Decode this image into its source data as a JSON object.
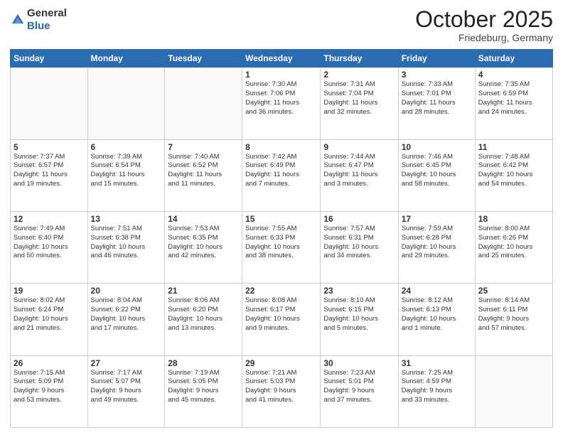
{
  "logo": {
    "general": "General",
    "blue": "Blue"
  },
  "header": {
    "month": "October 2025",
    "location": "Friedeburg, Germany"
  },
  "days": [
    "Sunday",
    "Monday",
    "Tuesday",
    "Wednesday",
    "Thursday",
    "Friday",
    "Saturday"
  ],
  "weeks": [
    [
      {
        "day": "",
        "content": ""
      },
      {
        "day": "",
        "content": ""
      },
      {
        "day": "",
        "content": ""
      },
      {
        "day": "1",
        "content": "Sunrise: 7:30 AM\nSunset: 7:06 PM\nDaylight: 11 hours\nand 36 minutes."
      },
      {
        "day": "2",
        "content": "Sunrise: 7:31 AM\nSunset: 7:04 PM\nDaylight: 11 hours\nand 32 minutes."
      },
      {
        "day": "3",
        "content": "Sunrise: 7:33 AM\nSunset: 7:01 PM\nDaylight: 11 hours\nand 28 minutes."
      },
      {
        "day": "4",
        "content": "Sunrise: 7:35 AM\nSunset: 6:59 PM\nDaylight: 11 hours\nand 24 minutes."
      }
    ],
    [
      {
        "day": "5",
        "content": "Sunrise: 7:37 AM\nSunset: 6:57 PM\nDaylight: 11 hours\nand 19 minutes."
      },
      {
        "day": "6",
        "content": "Sunrise: 7:39 AM\nSunset: 6:54 PM\nDaylight: 11 hours\nand 15 minutes."
      },
      {
        "day": "7",
        "content": "Sunrise: 7:40 AM\nSunset: 6:52 PM\nDaylight: 11 hours\nand 11 minutes."
      },
      {
        "day": "8",
        "content": "Sunrise: 7:42 AM\nSunset: 6:49 PM\nDaylight: 11 hours\nand 7 minutes."
      },
      {
        "day": "9",
        "content": "Sunrise: 7:44 AM\nSunset: 6:47 PM\nDaylight: 11 hours\nand 3 minutes."
      },
      {
        "day": "10",
        "content": "Sunrise: 7:46 AM\nSunset: 6:45 PM\nDaylight: 10 hours\nand 58 minutes."
      },
      {
        "day": "11",
        "content": "Sunrise: 7:48 AM\nSunset: 6:42 PM\nDaylight: 10 hours\nand 54 minutes."
      }
    ],
    [
      {
        "day": "12",
        "content": "Sunrise: 7:49 AM\nSunset: 6:40 PM\nDaylight: 10 hours\nand 50 minutes."
      },
      {
        "day": "13",
        "content": "Sunrise: 7:51 AM\nSunset: 6:38 PM\nDaylight: 10 hours\nand 46 minutes."
      },
      {
        "day": "14",
        "content": "Sunrise: 7:53 AM\nSunset: 6:35 PM\nDaylight: 10 hours\nand 42 minutes."
      },
      {
        "day": "15",
        "content": "Sunrise: 7:55 AM\nSunset: 6:33 PM\nDaylight: 10 hours\nand 38 minutes."
      },
      {
        "day": "16",
        "content": "Sunrise: 7:57 AM\nSunset: 6:31 PM\nDaylight: 10 hours\nand 34 minutes."
      },
      {
        "day": "17",
        "content": "Sunrise: 7:59 AM\nSunset: 6:28 PM\nDaylight: 10 hours\nand 29 minutes."
      },
      {
        "day": "18",
        "content": "Sunrise: 8:00 AM\nSunset: 6:26 PM\nDaylight: 10 hours\nand 25 minutes."
      }
    ],
    [
      {
        "day": "19",
        "content": "Sunrise: 8:02 AM\nSunset: 6:24 PM\nDaylight: 10 hours\nand 21 minutes."
      },
      {
        "day": "20",
        "content": "Sunrise: 8:04 AM\nSunset: 6:22 PM\nDaylight: 10 hours\nand 17 minutes."
      },
      {
        "day": "21",
        "content": "Sunrise: 8:06 AM\nSunset: 6:20 PM\nDaylight: 10 hours\nand 13 minutes."
      },
      {
        "day": "22",
        "content": "Sunrise: 8:08 AM\nSunset: 6:17 PM\nDaylight: 10 hours\nand 9 minutes."
      },
      {
        "day": "23",
        "content": "Sunrise: 8:10 AM\nSunset: 6:15 PM\nDaylight: 10 hours\nand 5 minutes."
      },
      {
        "day": "24",
        "content": "Sunrise: 8:12 AM\nSunset: 6:13 PM\nDaylight: 10 hours\nand 1 minute."
      },
      {
        "day": "25",
        "content": "Sunrise: 8:14 AM\nSunset: 6:11 PM\nDaylight: 9 hours\nand 57 minutes."
      }
    ],
    [
      {
        "day": "26",
        "content": "Sunrise: 7:15 AM\nSunset: 5:09 PM\nDaylight: 9 hours\nand 53 minutes."
      },
      {
        "day": "27",
        "content": "Sunrise: 7:17 AM\nSunset: 5:07 PM\nDaylight: 9 hours\nand 49 minutes."
      },
      {
        "day": "28",
        "content": "Sunrise: 7:19 AM\nSunset: 5:05 PM\nDaylight: 9 hours\nand 45 minutes."
      },
      {
        "day": "29",
        "content": "Sunrise: 7:21 AM\nSunset: 5:03 PM\nDaylight: 9 hours\nand 41 minutes."
      },
      {
        "day": "30",
        "content": "Sunrise: 7:23 AM\nSunset: 5:01 PM\nDaylight: 9 hours\nand 37 minutes."
      },
      {
        "day": "31",
        "content": "Sunrise: 7:25 AM\nSunset: 4:59 PM\nDaylight: 9 hours\nand 33 minutes."
      },
      {
        "day": "",
        "content": ""
      }
    ]
  ]
}
